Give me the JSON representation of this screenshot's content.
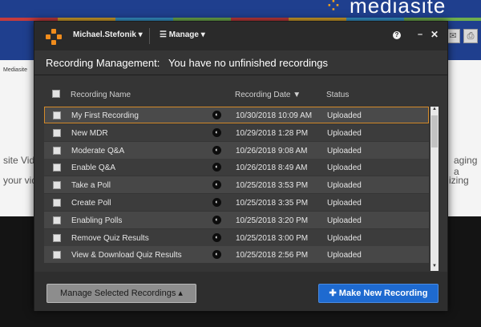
{
  "background": {
    "logo_text": "mediasite",
    "breadcrumb": "Mediasite",
    "text_line1": "site Vide",
    "text_line2": "your vid",
    "text_line3": "aging a",
    "text_line4": "izing"
  },
  "topbar": {
    "user_label": "Michael.Stefonik ▾",
    "manage_label": "☰ Manage ▾",
    "help_glyph": "?",
    "minimize_glyph": "–",
    "close_glyph": "✕"
  },
  "dialog": {
    "title": "Recording Management:   You have no unfinished recordings"
  },
  "table": {
    "columns": [
      "Recording Name",
      "Recording Date ▼",
      "Status"
    ],
    "rows": [
      {
        "name": "My First Recording",
        "date": "10/30/2018 10:09 AM",
        "status": "Uploaded"
      },
      {
        "name": "New MDR",
        "date": "10/29/2018 1:28 PM",
        "status": "Uploaded"
      },
      {
        "name": "Moderate Q&A",
        "date": "10/26/2018 9:08 AM",
        "status": "Uploaded"
      },
      {
        "name": "Enable Q&A",
        "date": "10/26/2018 8:49 AM",
        "status": "Uploaded"
      },
      {
        "name": "Take a Poll",
        "date": "10/25/2018 3:53 PM",
        "status": "Uploaded"
      },
      {
        "name": "Create Poll",
        "date": "10/25/2018 3:35 PM",
        "status": "Uploaded"
      },
      {
        "name": "Enabling Polls",
        "date": "10/25/2018 3:20 PM",
        "status": "Uploaded"
      },
      {
        "name": "Remove Quiz Results",
        "date": "10/25/2018 3:00 PM",
        "status": "Uploaded"
      },
      {
        "name": "View & Download Quiz Results",
        "date": "10/25/2018 2:56 PM",
        "status": "Uploaded"
      }
    ]
  },
  "footer": {
    "manage_selected_label": "Manage Selected Recordings ▴",
    "new_recording_label": "✚ Make New Recording"
  },
  "colors": {
    "accent_orange": "#f08c1c",
    "primary_button": "#1e6ad0",
    "selected_row_border": "#d48a2a"
  }
}
